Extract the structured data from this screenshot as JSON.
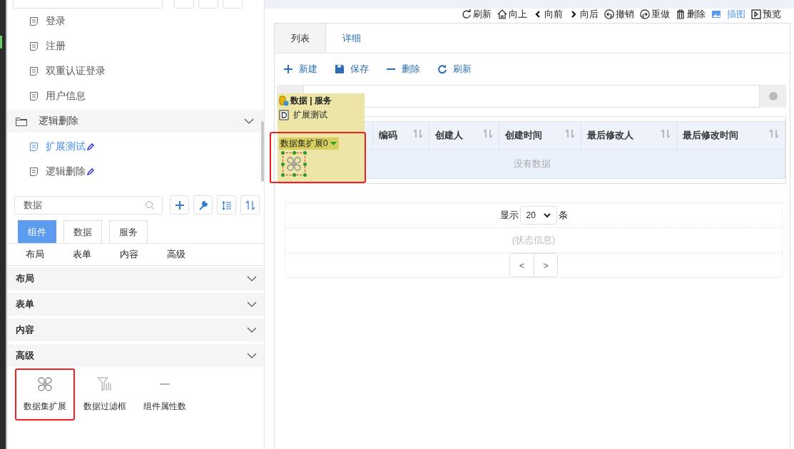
{
  "left_panel": {
    "tree": [
      {
        "label": "登录",
        "kind": "page",
        "selected": false,
        "editable": false
      },
      {
        "label": "注册",
        "kind": "page",
        "selected": false,
        "editable": false
      },
      {
        "label": "双重认证登录",
        "kind": "page",
        "selected": false,
        "editable": false
      },
      {
        "label": "用户信息",
        "kind": "page",
        "selected": false,
        "editable": false
      },
      {
        "label": "逻辑删除",
        "kind": "folder",
        "children": [
          {
            "label": "扩展测试",
            "kind": "page",
            "selected": true,
            "editable": true
          },
          {
            "label": "逻辑删除",
            "kind": "page",
            "selected": false,
            "editable": true
          }
        ]
      }
    ],
    "search": {
      "value": "数据"
    },
    "tools": [
      {
        "kind": "add"
      },
      {
        "kind": "wrench"
      },
      {
        "kind": "indent"
      },
      {
        "kind": "sort"
      }
    ],
    "tabs": [
      {
        "label": "组件",
        "selected": true
      },
      {
        "label": "数据",
        "selected": false
      },
      {
        "label": "服务",
        "selected": false
      }
    ],
    "categories": [
      "布局",
      "表单",
      "内容",
      "高级"
    ],
    "sections": [
      "布局",
      "表单",
      "内容",
      "高级"
    ],
    "components": [
      {
        "label": "数据集扩展",
        "kind": "clover",
        "highlighted": true
      },
      {
        "label": "数据过滤框",
        "kind": "filter",
        "highlighted": false
      },
      {
        "label": "组件属性数",
        "kind": "dash",
        "highlighted": false
      }
    ]
  },
  "toolbar": [
    {
      "label": "刷新",
      "kind": "refresh",
      "active": false
    },
    {
      "label": "向上",
      "kind": "home",
      "active": false
    },
    {
      "label": "向前",
      "kind": "back",
      "active": false
    },
    {
      "label": "向后",
      "kind": "forward",
      "active": false
    },
    {
      "label": "撤销",
      "kind": "undo",
      "active": false
    },
    {
      "label": "重做",
      "kind": "redo",
      "active": false
    },
    {
      "label": "删除",
      "kind": "trash",
      "active": false
    },
    {
      "label": "插图",
      "kind": "image",
      "active": true
    },
    {
      "label": "预览",
      "kind": "preview",
      "active": false
    }
  ],
  "tabs": [
    {
      "label": "列表",
      "selected": true
    },
    {
      "label": "详细",
      "selected": false
    }
  ],
  "actions": [
    {
      "label": "新建",
      "kind": "add"
    },
    {
      "label": "保存",
      "kind": "save"
    },
    {
      "label": "删除",
      "kind": "remove"
    },
    {
      "label": "刷新",
      "kind": "refresh"
    }
  ],
  "table": {
    "columns": [
      "编码",
      "创建人",
      "创建时间",
      "最后修改人",
      "最后修改时间"
    ],
    "empty_text": "没有数据"
  },
  "footer": {
    "show_label": "显示",
    "page_size": "20",
    "unit_label": "条",
    "status": "(状态信息)",
    "pager": [
      "<",
      ">"
    ]
  },
  "overlay": {
    "source": "数据 | 服务",
    "page": "扩展测试",
    "component": "数据集扩展0",
    "highlighted": true
  }
}
